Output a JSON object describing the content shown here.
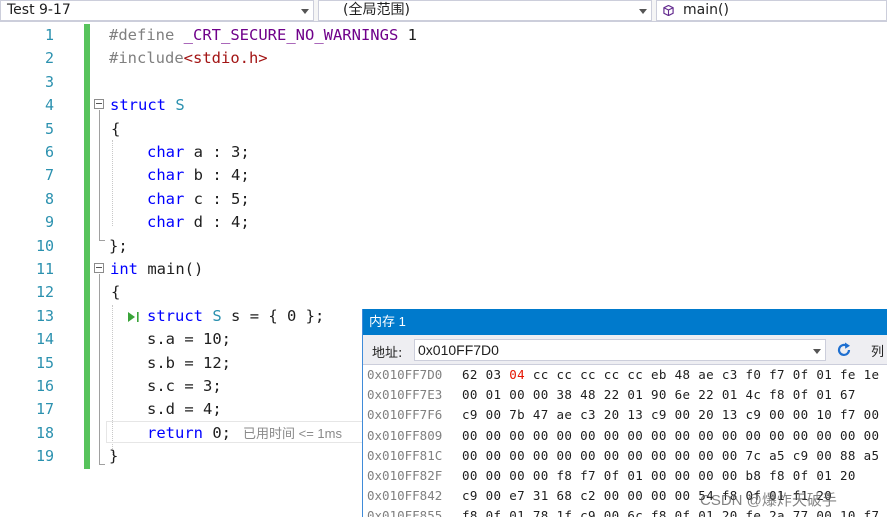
{
  "navbar": {
    "project": "Test 9-17",
    "scope": "(全局范围)",
    "function": "main()"
  },
  "editor": {
    "line_numbers": [
      "1",
      "2",
      "3",
      "4",
      "5",
      "6",
      "7",
      "8",
      "9",
      "10",
      "11",
      "12",
      "13",
      "14",
      "15",
      "16",
      "17",
      "18",
      "19"
    ],
    "lines": {
      "l1_kw": "#define",
      "l1_macro": "_CRT_SECURE_NO_WARNINGS",
      "l1_val": "1",
      "l2_kw": "#include",
      "l2_hdr": "<stdio.h>",
      "l4_kw": "struct",
      "l4_type": "S",
      "l5": "{",
      "l6_kw": "char",
      "l6_rest": "a : 3;",
      "l7_kw": "char",
      "l7_rest": "b : 4;",
      "l8_kw": "char",
      "l8_rest": "c : 5;",
      "l9_kw": "char",
      "l9_rest": "d : 4;",
      "l10": "};",
      "l11_kw": "int",
      "l11_rest": "main()",
      "l12": "{",
      "l13_kw": "struct",
      "l13_type": "S",
      "l13_rest": "s = { 0 };",
      "l14": "s.a = 10;",
      "l15": "s.b = 12;",
      "l16": "s.c = 3;",
      "l17": "s.d = 4;",
      "l18_kw": "return",
      "l18_rest": "0;",
      "l18_elapsed": "已用时间 <= 1ms",
      "l19": "}"
    }
  },
  "memory_window": {
    "title": "内存 1",
    "address_label": "地址:",
    "address_value": "0x010FF7D0",
    "columns_label": "列",
    "rows": [
      {
        "addr": "0x010FF7D0",
        "pre": "62 03 ",
        "changed": "04",
        "post": " cc cc cc cc cc eb 48 ae c3 f0 f7 0f 01 fe 1e"
      },
      {
        "addr": "0x010FF7E3",
        "pre": "00 01 00 00 38 48 22 01 90 6e 22 01 4c f8 0f 01 67",
        "changed": "",
        "post": ""
      },
      {
        "addr": "0x010FF7F6",
        "pre": "c9 00 7b 47 ae c3 20 13 c9 00 20 13 c9 00 00 10 f7 00",
        "changed": "",
        "post": ""
      },
      {
        "addr": "0x010FF809",
        "pre": "00 00 00 00 00 00 00 00 00 00 00 00 00 00 00 00 00 00",
        "changed": "",
        "post": ""
      },
      {
        "addr": "0x010FF81C",
        "pre": "00 00 00 00 00 00 00 00 00 00 00 00 7c a5 c9 00 88 a5",
        "changed": "",
        "post": ""
      },
      {
        "addr": "0x010FF82F",
        "pre": "00 00 00 00 f8 f7 0f 01 00 00 00 00 b8 f8 0f 01 20",
        "changed": "",
        "post": ""
      },
      {
        "addr": "0x010FF842",
        "pre": "c9 00 e7 31 68 c2 00 00 00 00 54 f8 0f 01 f1 20",
        "changed": "",
        "post": ""
      },
      {
        "addr": "0x010FF855",
        "pre": "f8 0f 01 78 1f c9 00 6c f8 0f 01 20 fe 2a 77 00 10 f7",
        "changed": "",
        "post": ""
      }
    ]
  },
  "watermark": "CSDN @爆炸天破手",
  "colors": {
    "keyword": "#0000ff",
    "type": "#2b91af",
    "preprocessor": "#808080",
    "macro": "#6f008a",
    "header_string": "#a31515",
    "line_number": "#2b91af",
    "change_bar": "#57c35c",
    "memory_title_bg": "#007acc",
    "changed_byte": "#e51400"
  },
  "icons": {
    "function_icon": "purple-cube-icon",
    "refresh_icon": "refresh-icon",
    "run_icon": "run-to-click-icon"
  }
}
